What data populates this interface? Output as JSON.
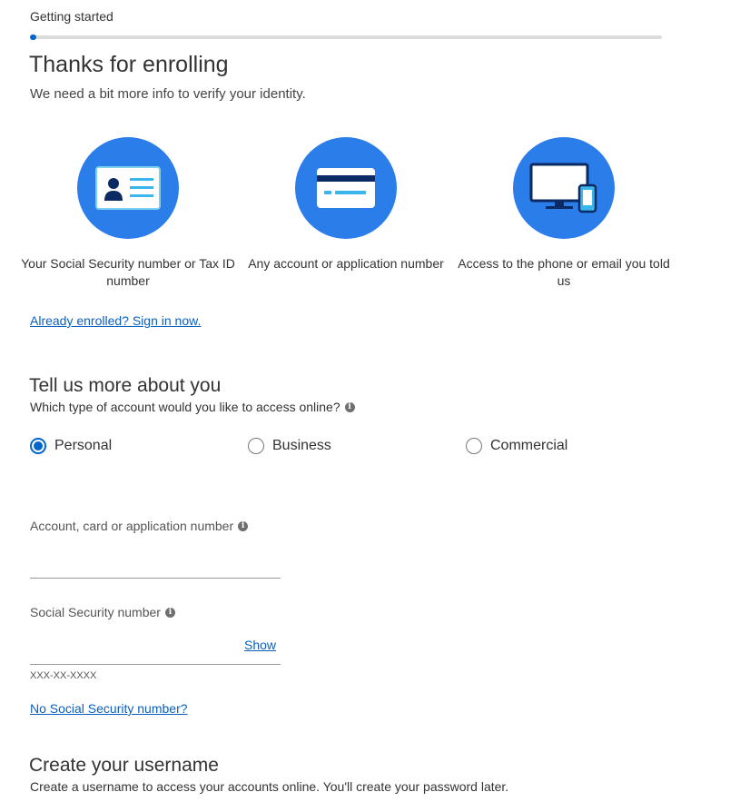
{
  "progress": {
    "label": "Getting started",
    "percent": 1
  },
  "header": {
    "title": "Thanks for enrolling",
    "subtitle": "We need a bit more info to verify your identity."
  },
  "requirements": [
    {
      "icon": "id-card-icon",
      "caption": "Your Social Security number or Tax ID number"
    },
    {
      "icon": "credit-card-icon",
      "caption": "Any account or application number"
    },
    {
      "icon": "monitor-phone-icon",
      "caption": "Access to the phone or email you told us"
    }
  ],
  "enrolled_link": "Already enrolled? Sign in now.",
  "about": {
    "title": "Tell us more about you",
    "question": "Which type of account would you like to access online?",
    "options": [
      {
        "label": "Personal",
        "selected": true
      },
      {
        "label": "Business",
        "selected": false
      },
      {
        "label": "Commercial",
        "selected": false
      }
    ]
  },
  "fields": {
    "account": {
      "label": "Account, card or application number",
      "value": ""
    },
    "ssn": {
      "label": "Social Security number",
      "value": "",
      "show": "Show",
      "hint": "XXX-XX-XXXX"
    }
  },
  "no_ssn_link": "No Social Security number?",
  "username": {
    "title": "Create your username",
    "description": "Create a username to access your accounts online. You'll create your password later."
  },
  "colors": {
    "accent": "#2b7de9",
    "link": "#0a5fbf",
    "progress": "#0066cc"
  }
}
